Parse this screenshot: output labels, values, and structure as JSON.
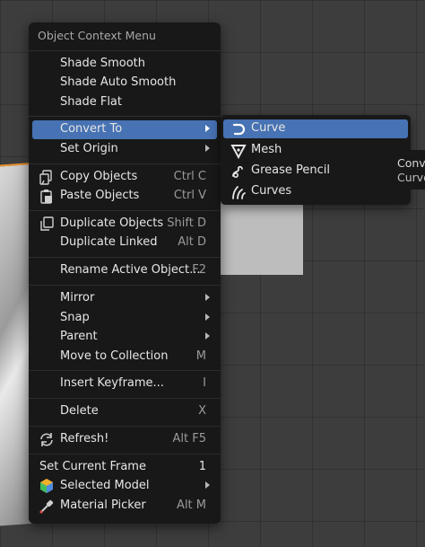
{
  "context_menu": {
    "title": "Object Context Menu",
    "items": [
      {
        "label": "Shade Smooth",
        "shortcut": "",
        "submenu": false
      },
      {
        "label": "Shade Auto Smooth",
        "shortcut": "",
        "submenu": false
      },
      {
        "label": "Shade Flat",
        "shortcut": "",
        "submenu": false
      },
      {
        "label": "Convert To",
        "shortcut": "",
        "submenu": true,
        "active": true
      },
      {
        "label": "Set Origin",
        "shortcut": "",
        "submenu": true
      },
      {
        "label": "Copy Objects",
        "shortcut": "Ctrl C",
        "icon": "copy-icon"
      },
      {
        "label": "Paste Objects",
        "shortcut": "Ctrl V",
        "icon": "paste-icon"
      },
      {
        "label": "Duplicate Objects",
        "shortcut": "Shift D",
        "icon": "duplicate-icon"
      },
      {
        "label": "Duplicate Linked",
        "shortcut": "Alt D"
      },
      {
        "label": "Rename Active Object...",
        "shortcut": "F2"
      },
      {
        "label": "Mirror",
        "shortcut": "",
        "submenu": true
      },
      {
        "label": "Snap",
        "shortcut": "",
        "submenu": true
      },
      {
        "label": "Parent",
        "shortcut": "",
        "submenu": true
      },
      {
        "label": "Move to Collection",
        "shortcut": "M"
      },
      {
        "label": "Insert Keyframe...",
        "shortcut": "I"
      },
      {
        "label": "Delete",
        "shortcut": "X"
      },
      {
        "label": "Refresh!",
        "shortcut": "Alt F5",
        "icon": "refresh-icon"
      },
      {
        "label": "Set Current Frame",
        "shortcut": "1"
      },
      {
        "label": "Selected Model",
        "shortcut": "",
        "submenu": true,
        "icon": "colorful-hexagon-icon"
      },
      {
        "label": "Material Picker",
        "shortcut": "Alt M",
        "icon": "eyedropper-icon"
      }
    ]
  },
  "convert_submenu": {
    "items": [
      {
        "label": "Curve",
        "icon": "curve-icon",
        "active": true
      },
      {
        "label": "Mesh",
        "icon": "mesh-icon"
      },
      {
        "label": "Grease Pencil",
        "icon": "grease-pencil-icon"
      },
      {
        "label": "Curves",
        "icon": "curves-icon"
      }
    ]
  },
  "tooltip": {
    "line1": "Conv",
    "line2": "Curve"
  },
  "colors": {
    "highlight": "#4772b3",
    "menu_bg": "#181818",
    "text": "#e6e6e6",
    "shortcut_text": "#9a9a9a",
    "selection_outline": "#e8902b"
  }
}
